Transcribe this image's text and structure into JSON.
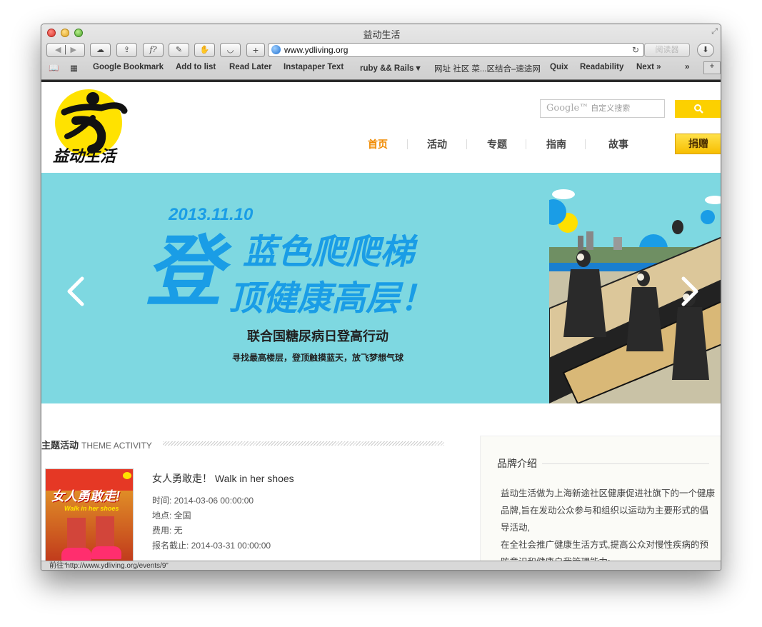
{
  "window": {
    "title": "益动生活"
  },
  "toolbar": {
    "url": "www.ydliving.org",
    "reader_label": "阅读器",
    "new_tab_label": "+"
  },
  "bookmarks": [
    "Google Bookmark",
    "Add to list",
    "Read Later",
    "Instapaper Text",
    "ruby && Rails ▾",
    "网址 社区 菜...区结合–速途网",
    "Quix",
    "Readability",
    "Next »"
  ],
  "header": {
    "logo_text": "益动生活",
    "search_placeholder_brand": "Google™",
    "search_placeholder": "自定义搜索",
    "nav": [
      {
        "label": "首页",
        "active": true
      },
      {
        "label": "活动",
        "active": false
      },
      {
        "label": "专题",
        "active": false
      },
      {
        "label": "指南",
        "active": false
      },
      {
        "label": "故事",
        "active": false
      }
    ],
    "donate_label": "捐赠"
  },
  "banner": {
    "date": "2013.11.10",
    "big_char": "登",
    "line1": "蓝色爬爬梯",
    "line2": "顶健康高层！",
    "subtitle": "联合国糖尿病日登高行动",
    "tagline": "寻找最高楼层，登顶触摸蓝天，放飞梦想气球"
  },
  "theme_section": {
    "title": "主题活动",
    "title_en": "THEME ACTIVITY",
    "event": {
      "title": "女人勇敢走！ Walk in her shoes",
      "thumb_text": "女人勇敢走!",
      "thumb_sub": "Walk in her shoes",
      "time": "时间: 2014-03-06 00:00:00",
      "place": "地点: 全国",
      "fee": "费用: 无",
      "deadline": "报名截止: 2014-03-31 00:00:00"
    }
  },
  "brand": {
    "title": "品牌介绍",
    "lines": [
      "益动生活做为上海新途社区健康促进社旗下的一个健康",
      "品牌,旨在发动公众参与和组织以运动为主要形式的倡",
      "导活动,",
      "在全社会推广健康生活方式,提高公众对慢性疾病的预",
      "防意识和健康自我管理能力;"
    ]
  },
  "status_bar": {
    "text": "前往“http://www.ydliving.org/events/9”"
  },
  "colors": {
    "accent": "#fcd000",
    "nav_active": "#f08a00",
    "banner_bg": "#7ed8e1",
    "banner_text": "#1a9de6"
  }
}
